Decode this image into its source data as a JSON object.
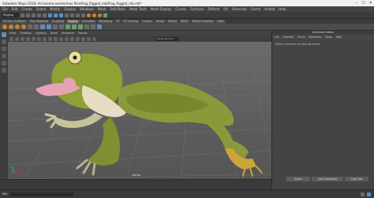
{
  "window": {
    "title": "Autodesk Maya 2018: H:/cinema-assets/max files/frog_Rigged_mb/Frog_Rigged_mb.mb*",
    "controls": [
      "–",
      "☐",
      "✕"
    ]
  },
  "menubar": {
    "items": [
      "File",
      "Edit",
      "Create",
      "Select",
      "Modify",
      "Display",
      "Windows",
      "Mesh",
      "Edit Mesh",
      "Mesh Tools",
      "Mesh Display",
      "Curves",
      "Surfaces",
      "Deform",
      "UV",
      "Generate",
      "Cache",
      "Arnold",
      "Help"
    ]
  },
  "statusline": {
    "mode": "Rigging"
  },
  "shelf": {
    "tabs": [
      "Curves / Surfaces",
      "Poly Modeling",
      "Sculpting",
      "Rigging",
      "Animation",
      "Rendering",
      "FX",
      "FX Caching",
      "Custom",
      "Arnold",
      "Bifrost",
      "MASH",
      "Motion Graphics",
      "XGen"
    ],
    "active_tab": "Rigging"
  },
  "viewport": {
    "menu": [
      "View",
      "Shading",
      "Lighting",
      "Show",
      "Renderer",
      "Panels"
    ],
    "colorspace": "sRGB gamma",
    "camera_label": "persp"
  },
  "attribute_panel": {
    "title": "Attribute Editor",
    "tabs": [
      "List",
      "Selected",
      "Focus",
      "Attributes",
      "Show",
      "Help"
    ],
    "message": "Make a selection to show attributes",
    "buttons": [
      "Select",
      "Load Attributes",
      "Copy Tab"
    ]
  },
  "mel": {
    "label": "MEL"
  },
  "colors": {
    "frog_body": "#8a9a3a",
    "frog_belly": "#e8dcc4",
    "tongue": "#e7a3b4",
    "eye": "#e9e0a0",
    "grid": "#7a7a7a"
  }
}
